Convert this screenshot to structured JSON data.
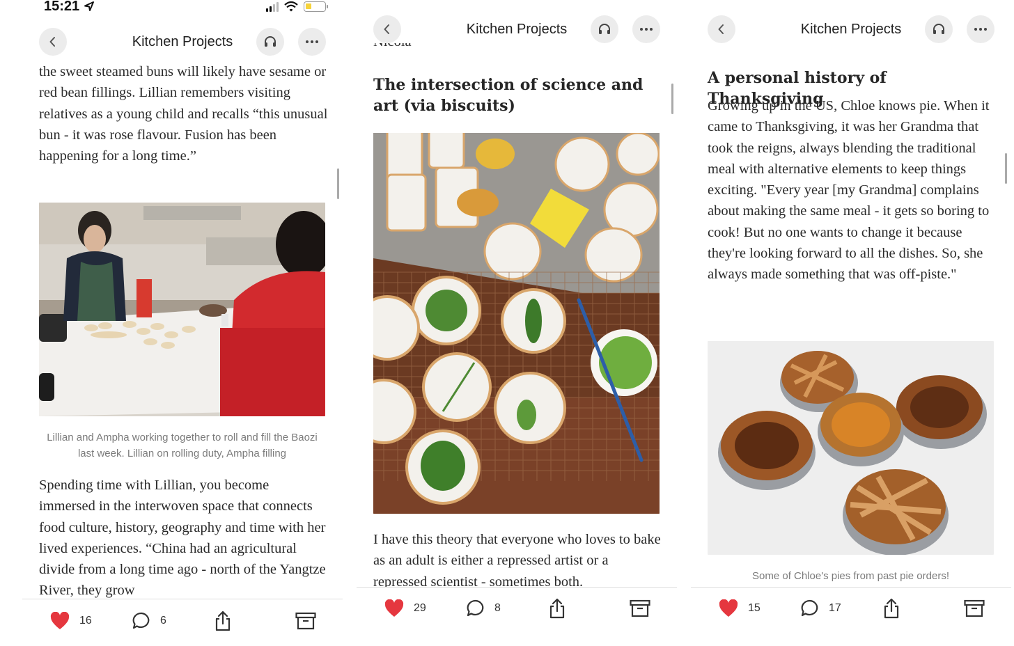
{
  "status": {
    "time": "15:21"
  },
  "panels": [
    {
      "title": "Kitchen Projects",
      "paragraph_top": "the sweet steamed buns will likely have sesame or red bean fillings. Lillian remembers visiting relatives as a young child and recalls “this unusual bun - it was rose flavour. Fusion has been happening for a long time.”",
      "caption": "Lillian and Ampha working together to roll and fill the Baozi last week. Lillian on rolling duty, Ampha filling",
      "paragraph_bottom": "Spending time with Lillian, you become immersed in the interwoven space that connects food culture, history, geography and time with her lived experiences. “China had an agricultural divide from a long time ago - north of the Yangtze River, they grow",
      "likes": "16",
      "comments": "6"
    },
    {
      "title": "Kitchen Projects",
      "clipped_text": "Nicola",
      "heading": "The intersection of science and art (via biscuits)",
      "paragraph_bottom": "I have this theory that everyone who loves to bake as an adult is either a repressed artist or a repressed scientist - sometimes both.",
      "likes": "29",
      "comments": "8"
    },
    {
      "title": "Kitchen Projects",
      "heading": "A personal history of Thanksgiving",
      "paragraph_top": "Growing up in the US, Chloe knows pie. When it came to Thanksgiving, it was her Grandma that took the reigns, always blending the traditional meal with alternative elements to keep things exciting. \"Every year [my Grandma] complains about making the same meal - it gets so boring to cook! But no one wants to change it because they're looking forward to all the dishes. So, she always made something that was off-piste.\"",
      "caption": "Some of Chloe's pies from past pie orders!",
      "likes": "15",
      "comments": "17"
    }
  ],
  "icons": {
    "back": "chevron-left-icon",
    "listen": "headphones-icon",
    "more": "more-icon",
    "like": "heart-icon",
    "comment": "comment-icon",
    "share": "share-icon",
    "archive": "archive-icon"
  },
  "colors": {
    "heart": "#e5373f",
    "button_bg": "#ececec"
  }
}
